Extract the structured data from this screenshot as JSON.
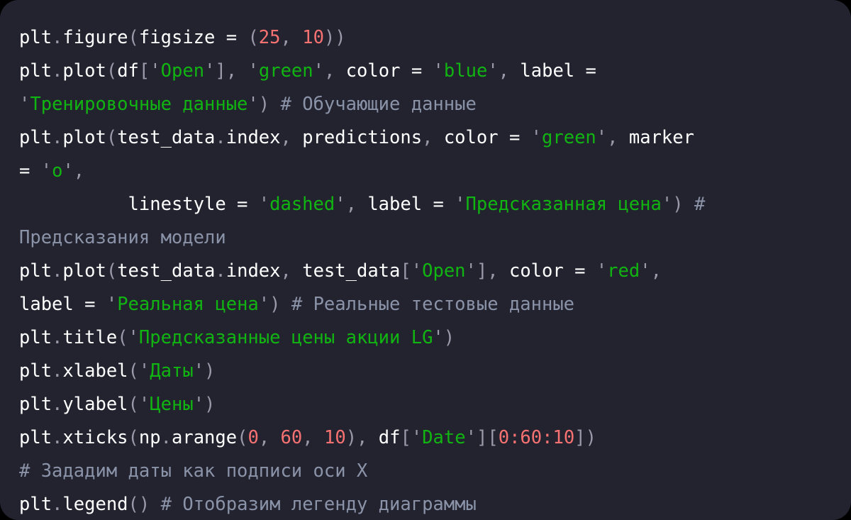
{
  "editor": {
    "background_color": "#232330",
    "page_background_color": "#000000",
    "language": "python",
    "colors": {
      "plain": "#ffffff",
      "punctuation": "#9a9aab",
      "string": "#11b511",
      "quote": "#9a9aab",
      "number": "#f87272",
      "comment": "#8b93a8"
    }
  },
  "code": {
    "lines": [
      {
        "id": "line-1",
        "tokens": [
          {
            "t": "plt",
            "c": "plain"
          },
          {
            "t": ".",
            "c": "punct"
          },
          {
            "t": "figure",
            "c": "plain"
          },
          {
            "t": "(",
            "c": "punct"
          },
          {
            "t": "figsize",
            "c": "plain"
          },
          {
            "t": " = ",
            "c": "plain"
          },
          {
            "t": "(",
            "c": "punct"
          },
          {
            "t": "25",
            "c": "num"
          },
          {
            "t": ", ",
            "c": "punct"
          },
          {
            "t": "10",
            "c": "num"
          },
          {
            "t": "))",
            "c": "punct"
          }
        ]
      },
      {
        "id": "line-2",
        "tokens": [
          {
            "t": "plt",
            "c": "plain"
          },
          {
            "t": ".",
            "c": "punct"
          },
          {
            "t": "plot",
            "c": "plain"
          },
          {
            "t": "(",
            "c": "punct"
          },
          {
            "t": "df",
            "c": "plain"
          },
          {
            "t": "[",
            "c": "punct"
          },
          {
            "t": "'",
            "c": "quote"
          },
          {
            "t": "Open",
            "c": "str"
          },
          {
            "t": "'",
            "c": "quote"
          },
          {
            "t": "]",
            "c": "punct"
          },
          {
            "t": ", ",
            "c": "punct"
          },
          {
            "t": "'",
            "c": "quote"
          },
          {
            "t": "green",
            "c": "str"
          },
          {
            "t": "'",
            "c": "quote"
          },
          {
            "t": ", ",
            "c": "punct"
          },
          {
            "t": "color",
            "c": "plain"
          },
          {
            "t": " = ",
            "c": "plain"
          },
          {
            "t": "'",
            "c": "quote"
          },
          {
            "t": "blue",
            "c": "str"
          },
          {
            "t": "'",
            "c": "quote"
          },
          {
            "t": ", ",
            "c": "punct"
          },
          {
            "t": "label",
            "c": "plain"
          },
          {
            "t": " =",
            "c": "plain"
          }
        ]
      },
      {
        "id": "line-3",
        "tokens": [
          {
            "t": "'",
            "c": "quote"
          },
          {
            "t": "Тренировочные данные",
            "c": "str"
          },
          {
            "t": "'",
            "c": "quote"
          },
          {
            "t": ")",
            "c": "punct"
          },
          {
            "t": " ",
            "c": "plain"
          },
          {
            "t": "# Обучающие данные",
            "c": "cmt"
          }
        ]
      },
      {
        "id": "line-4",
        "tokens": [
          {
            "t": "plt",
            "c": "plain"
          },
          {
            "t": ".",
            "c": "punct"
          },
          {
            "t": "plot",
            "c": "plain"
          },
          {
            "t": "(",
            "c": "punct"
          },
          {
            "t": "test_data",
            "c": "plain"
          },
          {
            "t": ".",
            "c": "punct"
          },
          {
            "t": "index",
            "c": "plain"
          },
          {
            "t": ", ",
            "c": "punct"
          },
          {
            "t": "predictions",
            "c": "plain"
          },
          {
            "t": ", ",
            "c": "punct"
          },
          {
            "t": "color",
            "c": "plain"
          },
          {
            "t": " = ",
            "c": "plain"
          },
          {
            "t": "'",
            "c": "quote"
          },
          {
            "t": "green",
            "c": "str"
          },
          {
            "t": "'",
            "c": "quote"
          },
          {
            "t": ", ",
            "c": "punct"
          },
          {
            "t": "marker",
            "c": "plain"
          }
        ]
      },
      {
        "id": "line-5",
        "tokens": [
          {
            "t": "= ",
            "c": "plain"
          },
          {
            "t": "'",
            "c": "quote"
          },
          {
            "t": "o",
            "c": "str"
          },
          {
            "t": "'",
            "c": "quote"
          },
          {
            "t": ",",
            "c": "punct"
          }
        ]
      },
      {
        "id": "line-6",
        "tokens": [
          {
            "t": "          ",
            "c": "plain"
          },
          {
            "t": "linestyle",
            "c": "plain"
          },
          {
            "t": " = ",
            "c": "plain"
          },
          {
            "t": "'",
            "c": "quote"
          },
          {
            "t": "dashed",
            "c": "str"
          },
          {
            "t": "'",
            "c": "quote"
          },
          {
            "t": ", ",
            "c": "punct"
          },
          {
            "t": "label",
            "c": "plain"
          },
          {
            "t": " = ",
            "c": "plain"
          },
          {
            "t": "'",
            "c": "quote"
          },
          {
            "t": "Предсказанная цена",
            "c": "str"
          },
          {
            "t": "'",
            "c": "quote"
          },
          {
            "t": ")",
            "c": "punct"
          },
          {
            "t": " ",
            "c": "plain"
          },
          {
            "t": "#",
            "c": "cmt"
          }
        ]
      },
      {
        "id": "line-7",
        "tokens": [
          {
            "t": "Предсказания модели",
            "c": "cmt"
          }
        ]
      },
      {
        "id": "line-8",
        "tokens": [
          {
            "t": "plt",
            "c": "plain"
          },
          {
            "t": ".",
            "c": "punct"
          },
          {
            "t": "plot",
            "c": "plain"
          },
          {
            "t": "(",
            "c": "punct"
          },
          {
            "t": "test_data",
            "c": "plain"
          },
          {
            "t": ".",
            "c": "punct"
          },
          {
            "t": "index",
            "c": "plain"
          },
          {
            "t": ", ",
            "c": "punct"
          },
          {
            "t": "test_data",
            "c": "plain"
          },
          {
            "t": "[",
            "c": "punct"
          },
          {
            "t": "'",
            "c": "quote"
          },
          {
            "t": "Open",
            "c": "str"
          },
          {
            "t": "'",
            "c": "quote"
          },
          {
            "t": "]",
            "c": "punct"
          },
          {
            "t": ", ",
            "c": "punct"
          },
          {
            "t": "color",
            "c": "plain"
          },
          {
            "t": " = ",
            "c": "plain"
          },
          {
            "t": "'",
            "c": "quote"
          },
          {
            "t": "red",
            "c": "str"
          },
          {
            "t": "'",
            "c": "quote"
          },
          {
            "t": ",",
            "c": "punct"
          }
        ]
      },
      {
        "id": "line-9",
        "tokens": [
          {
            "t": "label",
            "c": "plain"
          },
          {
            "t": " = ",
            "c": "plain"
          },
          {
            "t": "'",
            "c": "quote"
          },
          {
            "t": "Реальная цена",
            "c": "str"
          },
          {
            "t": "'",
            "c": "quote"
          },
          {
            "t": ")",
            "c": "punct"
          },
          {
            "t": " ",
            "c": "plain"
          },
          {
            "t": "# Реальные тестовые данные",
            "c": "cmt"
          }
        ]
      },
      {
        "id": "line-10",
        "tokens": [
          {
            "t": "plt",
            "c": "plain"
          },
          {
            "t": ".",
            "c": "punct"
          },
          {
            "t": "title",
            "c": "plain"
          },
          {
            "t": "(",
            "c": "punct"
          },
          {
            "t": "'",
            "c": "quote"
          },
          {
            "t": "Предсказанные цены акции LG",
            "c": "str"
          },
          {
            "t": "'",
            "c": "quote"
          },
          {
            "t": ")",
            "c": "punct"
          }
        ]
      },
      {
        "id": "line-11",
        "tokens": [
          {
            "t": "plt",
            "c": "plain"
          },
          {
            "t": ".",
            "c": "punct"
          },
          {
            "t": "xlabel",
            "c": "plain"
          },
          {
            "t": "(",
            "c": "punct"
          },
          {
            "t": "'",
            "c": "quote"
          },
          {
            "t": "Даты",
            "c": "str"
          },
          {
            "t": "'",
            "c": "quote"
          },
          {
            "t": ")",
            "c": "punct"
          }
        ]
      },
      {
        "id": "line-12",
        "tokens": [
          {
            "t": "plt",
            "c": "plain"
          },
          {
            "t": ".",
            "c": "punct"
          },
          {
            "t": "ylabel",
            "c": "plain"
          },
          {
            "t": "(",
            "c": "punct"
          },
          {
            "t": "'",
            "c": "quote"
          },
          {
            "t": "Цены",
            "c": "str"
          },
          {
            "t": "'",
            "c": "quote"
          },
          {
            "t": ")",
            "c": "punct"
          }
        ]
      },
      {
        "id": "line-13",
        "tokens": [
          {
            "t": "plt",
            "c": "plain"
          },
          {
            "t": ".",
            "c": "punct"
          },
          {
            "t": "xticks",
            "c": "plain"
          },
          {
            "t": "(",
            "c": "punct"
          },
          {
            "t": "np",
            "c": "plain"
          },
          {
            "t": ".",
            "c": "punct"
          },
          {
            "t": "arange",
            "c": "plain"
          },
          {
            "t": "(",
            "c": "punct"
          },
          {
            "t": "0",
            "c": "num"
          },
          {
            "t": ", ",
            "c": "punct"
          },
          {
            "t": "60",
            "c": "num"
          },
          {
            "t": ", ",
            "c": "punct"
          },
          {
            "t": "10",
            "c": "num"
          },
          {
            "t": "), ",
            "c": "punct"
          },
          {
            "t": "df",
            "c": "plain"
          },
          {
            "t": "[",
            "c": "punct"
          },
          {
            "t": "'",
            "c": "quote"
          },
          {
            "t": "Date",
            "c": "str"
          },
          {
            "t": "'",
            "c": "quote"
          },
          {
            "t": "][",
            "c": "punct"
          },
          {
            "t": "0",
            "c": "num"
          },
          {
            "t": ":",
            "c": "num"
          },
          {
            "t": "60",
            "c": "num"
          },
          {
            "t": ":",
            "c": "num"
          },
          {
            "t": "10",
            "c": "num"
          },
          {
            "t": "])",
            "c": "punct"
          }
        ]
      },
      {
        "id": "line-14",
        "tokens": [
          {
            "t": "# Зададим даты как подписи оси X",
            "c": "cmt"
          }
        ]
      },
      {
        "id": "line-15",
        "tokens": [
          {
            "t": "plt",
            "c": "plain"
          },
          {
            "t": ".",
            "c": "punct"
          },
          {
            "t": "legend",
            "c": "plain"
          },
          {
            "t": "()",
            "c": "punct"
          },
          {
            "t": " ",
            "c": "plain"
          },
          {
            "t": "# Отобразим легенду диаграммы",
            "c": "cmt"
          }
        ]
      }
    ]
  }
}
